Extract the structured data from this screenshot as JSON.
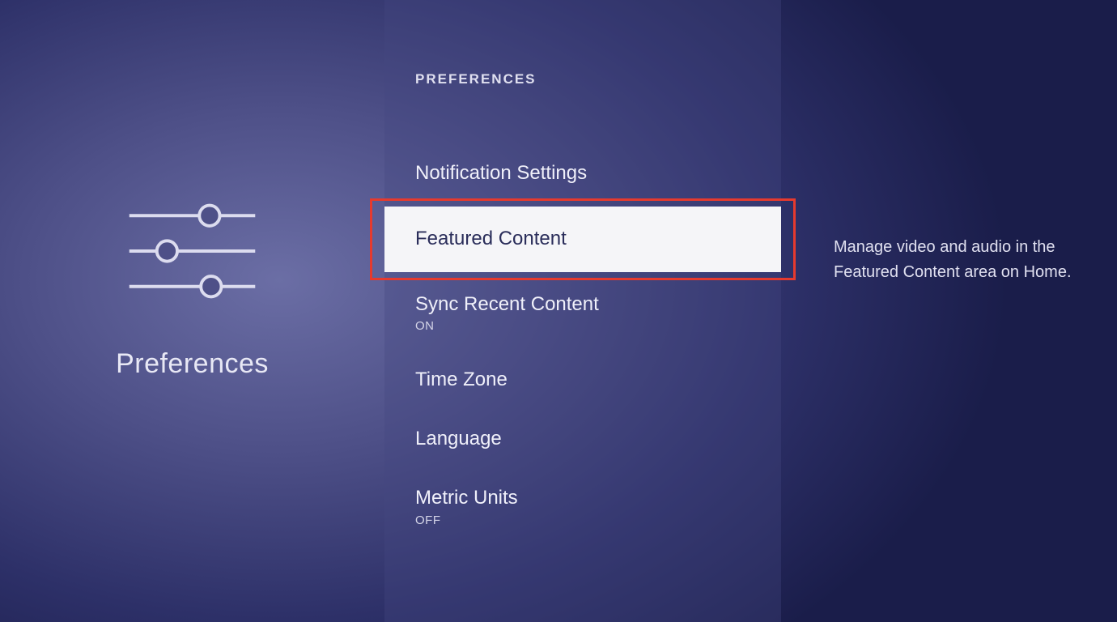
{
  "left": {
    "title": "Preferences"
  },
  "middle": {
    "header": "PREFERENCES",
    "items": [
      {
        "label": "Notification Settings",
        "sublabel": ""
      },
      {
        "label": "Featured Content",
        "sublabel": ""
      },
      {
        "label": "Sync Recent Content",
        "sublabel": "ON"
      },
      {
        "label": "Time Zone",
        "sublabel": ""
      },
      {
        "label": "Language",
        "sublabel": ""
      },
      {
        "label": "Metric Units",
        "sublabel": "OFF"
      }
    ],
    "selected_index": 1
  },
  "right": {
    "description": "Manage video and audio in the Featured Content area on Home."
  },
  "colors": {
    "highlight": "#e63a2e",
    "selected_bg": "#f5f5f8",
    "selected_text": "#2a2d5a"
  }
}
